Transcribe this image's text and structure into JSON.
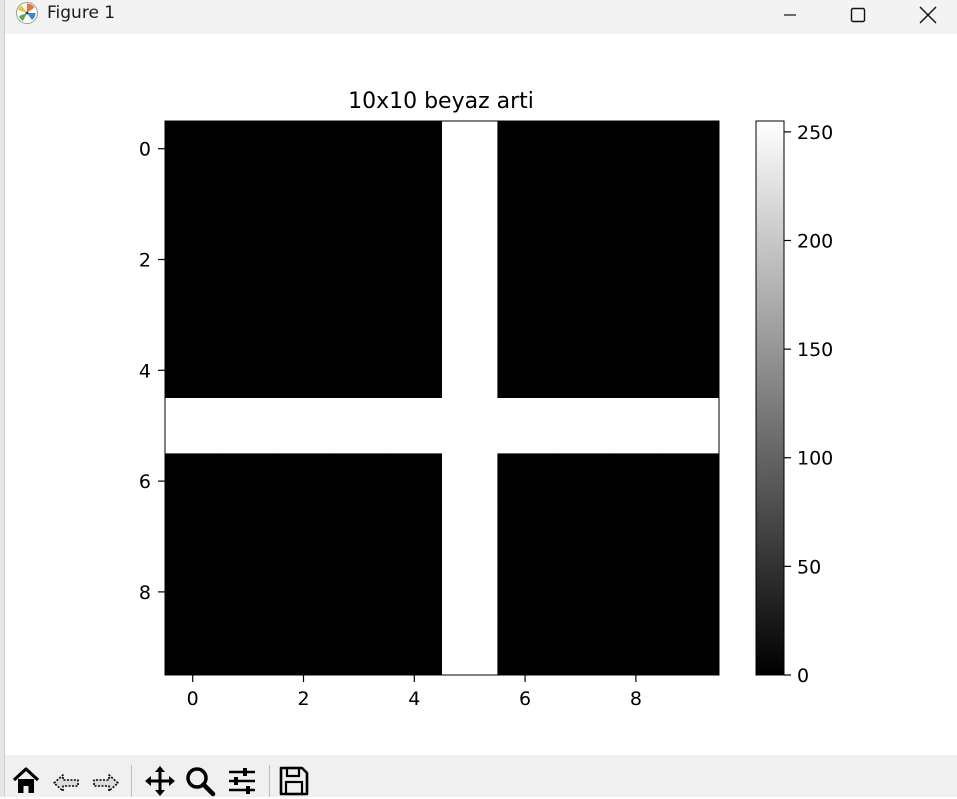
{
  "window": {
    "title": "Figure 1",
    "controls": [
      "minimize",
      "maximize",
      "close"
    ]
  },
  "toolbar": {
    "buttons": [
      "home-icon",
      "back-icon",
      "forward-icon",
      "pan-icon",
      "zoom-icon",
      "configure-subplots-icon",
      "save-icon"
    ]
  },
  "chart_data": {
    "type": "heatmap",
    "title": "10x10 beyaz arti",
    "xlabel": "",
    "ylabel": "",
    "colormap": "gray",
    "xlim": [
      -0.5,
      9.5
    ],
    "ylim": [
      9.5,
      -0.5
    ],
    "x_ticks": [
      0,
      2,
      4,
      6,
      8
    ],
    "y_ticks": [
      0,
      2,
      4,
      6,
      8
    ],
    "matrix": [
      [
        0,
        0,
        0,
        0,
        0,
        255,
        0,
        0,
        0,
        0
      ],
      [
        0,
        0,
        0,
        0,
        0,
        255,
        0,
        0,
        0,
        0
      ],
      [
        0,
        0,
        0,
        0,
        0,
        255,
        0,
        0,
        0,
        0
      ],
      [
        0,
        0,
        0,
        0,
        0,
        255,
        0,
        0,
        0,
        0
      ],
      [
        0,
        0,
        0,
        0,
        0,
        255,
        0,
        0,
        0,
        0
      ],
      [
        255,
        255,
        255,
        255,
        255,
        255,
        255,
        255,
        255,
        255
      ],
      [
        0,
        0,
        0,
        0,
        0,
        255,
        0,
        0,
        0,
        0
      ],
      [
        0,
        0,
        0,
        0,
        0,
        255,
        0,
        0,
        0,
        0
      ],
      [
        0,
        0,
        0,
        0,
        0,
        255,
        0,
        0,
        0,
        0
      ],
      [
        0,
        0,
        0,
        0,
        0,
        255,
        0,
        0,
        0,
        0
      ]
    ],
    "colorbar": {
      "range": [
        0,
        255
      ],
      "ticks": [
        0,
        50,
        100,
        150,
        200,
        250
      ]
    }
  }
}
